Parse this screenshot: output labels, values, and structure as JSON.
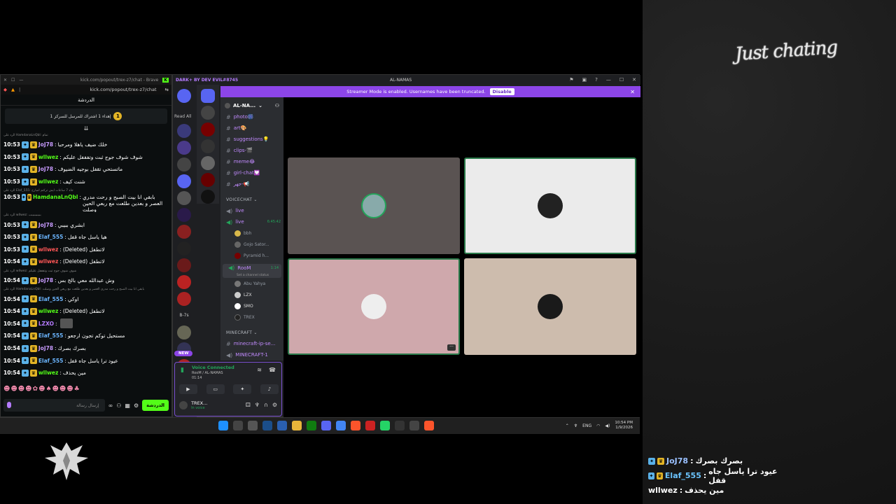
{
  "scene": {
    "title": "Just chating"
  },
  "kick": {
    "titlebar": "kick.com/popout/trex-z7/chat - Brave",
    "url": "kick.com/popout/trex-z7/chat",
    "header": "الدردشة",
    "pinned_text": "إهداء 1 اشتراك للمرسل للسركز 1",
    "messages": [
      {
        "kind": "reply",
        "text": "الرد على HamdanaLnQbl: تمام"
      },
      {
        "kind": "msg",
        "time": "10:53",
        "user": "JoJ78",
        "ucls": "u-joj",
        "text": "خلك ضيف ياهلا ومرحبا"
      },
      {
        "kind": "msg",
        "time": "10:53",
        "user": "wllwez",
        "ucls": "u-wll",
        "text": "شوف شوف جوج ثبت وتفففل عليكم"
      },
      {
        "kind": "msg",
        "time": "10:53",
        "user": "JoJ78",
        "ucls": "u-joj",
        "text": "ماتستحي تقفل بوجيه الضيوف"
      },
      {
        "kind": "msg",
        "time": "10:53",
        "user": "wllwez",
        "ucls": "u-wll",
        "text": "شنت كيف"
      },
      {
        "kind": "reply",
        "text": "الرد على Elaf_555: جاء 7 ساعات ايش تركتم امبارح"
      },
      {
        "kind": "two",
        "time": "10:53",
        "user": "HamdanaLnQbl",
        "ucls": "u-ham",
        "text": "بابقي انا بيت الصبح و رحت مدري العصر و بعدين طلعت مع ربعي الحين وصلت"
      },
      {
        "kind": "reply",
        "text": "الرد على wllwez: ببببببببببب"
      },
      {
        "kind": "msg",
        "time": "10:53",
        "user": "JoJ78",
        "ucls": "u-joj",
        "text": "ابشري ببيبي"
      },
      {
        "kind": "msg",
        "time": "10:53",
        "user": "Elaf_555",
        "ucls": "u-elaf",
        "text": "هيا ياسل جاه قفل"
      },
      {
        "kind": "msg",
        "time": "10:53",
        "user": "wllwez",
        "ucls": "u-wllr",
        "text": "(Deleted) لاتطفل"
      },
      {
        "kind": "msg",
        "time": "10:54",
        "user": "wllwez",
        "ucls": "u-wllr",
        "text": "(Deleted) لاتطفل"
      },
      {
        "kind": "reply",
        "text": "الرد على wllwez: شوف شوف جوج ثبت وتفففل عليكم"
      },
      {
        "kind": "msg",
        "time": "10:54",
        "user": "JoJ78",
        "ucls": "u-joj",
        "text": "وش عبدالله معي بالج بس"
      },
      {
        "kind": "reply",
        "text": "الرد على HamdanaLnQbl: بابقي انا بيت الصبح و رحت مدري العصر و بعدين طلعت مع ربعي الحين وصلت"
      },
      {
        "kind": "msg",
        "time": "10:54",
        "user": "Elaf_555",
        "ucls": "u-elaf",
        "text": "اوكي"
      },
      {
        "kind": "msg",
        "time": "10:54",
        "user": "wllwez",
        "ucls": "u-wll",
        "text": "(Deleted) لاتطفل"
      },
      {
        "kind": "msg",
        "time": "10:54",
        "user": "LZXO",
        "ucls": "u-lzx",
        "text": ""
      },
      {
        "kind": "msg",
        "time": "10:54",
        "user": "Elaf_555",
        "ucls": "u-elaf",
        "text": "مستحيل توكم تجون ارجعو"
      },
      {
        "kind": "msg",
        "time": "10:54",
        "user": "JoJ78",
        "ucls": "u-joj",
        "text": "بصرك بصرك"
      },
      {
        "kind": "msg",
        "time": "10:54",
        "user": "Elaf_555",
        "ucls": "u-elaf",
        "text": "عيود ترا ياسل جاه قفل"
      },
      {
        "kind": "msg",
        "time": "10:54",
        "user": "wllwez",
        "ucls": "u-wll",
        "text": "مين يحذف"
      }
    ],
    "input_placeholder": "إرسال رسالة",
    "chat_button": "الدردشة"
  },
  "discord": {
    "titlebar_left": "DARK+ BY DEV EVIL#8745",
    "titlebar_mid": "AL-NAMAS",
    "read_all": "Read All",
    "streamer_text": "Streamer Mode is enabled. Usernames have been truncated.",
    "disable_label": "Disable",
    "new_label": "NEW",
    "guild": "AL-NA...",
    "text_channels": [
      "photo🎆",
      "art🎨",
      "suggestions💡",
      "clips-🎬",
      "meme😂",
      "girl-chat💟",
      "جهر-📢"
    ],
    "voice_cat": "VOICECHAT",
    "voice_channels": [
      {
        "name": "live",
        "timer": ""
      },
      {
        "name": "live",
        "timer": "6:45:42"
      }
    ],
    "live_users": [
      "bbh",
      "Gojo Sator...",
      "Pyramid h..."
    ],
    "room": {
      "name": "RooM",
      "timer": "1:14",
      "status": "Set a channel status"
    },
    "room_users": [
      "Abu Yahya",
      "LZX",
      "SMO",
      "TREX"
    ],
    "mc_cat": "MINECRAFT",
    "mc_channels": [
      "minecraft-ip-se...",
      "MINECRAFT-1"
    ],
    "vc": {
      "title": "Voice Connected",
      "sub": "RooM / AL-NAMAS",
      "time": "01:14",
      "user": "TREX...",
      "status": "In voice"
    }
  },
  "taskbar": {
    "lang": "ENG",
    "time": "10:54 PM",
    "date": "1/9/2026"
  },
  "overlay": [
    {
      "user": "JoJ78",
      "cls": "n-joj",
      "text": "بصرك بصرك"
    },
    {
      "user": "Elaf_555",
      "cls": "n-elaf",
      "text": "عيود ترا ياسل جاه قفل"
    },
    {
      "user": "wllwez",
      "cls": "n-wll",
      "text": "مين يحذف"
    }
  ],
  "colors": {
    "kick_green": "#53fc18",
    "discord_purple": "#8c45e8",
    "voice_green": "#23a55a"
  }
}
